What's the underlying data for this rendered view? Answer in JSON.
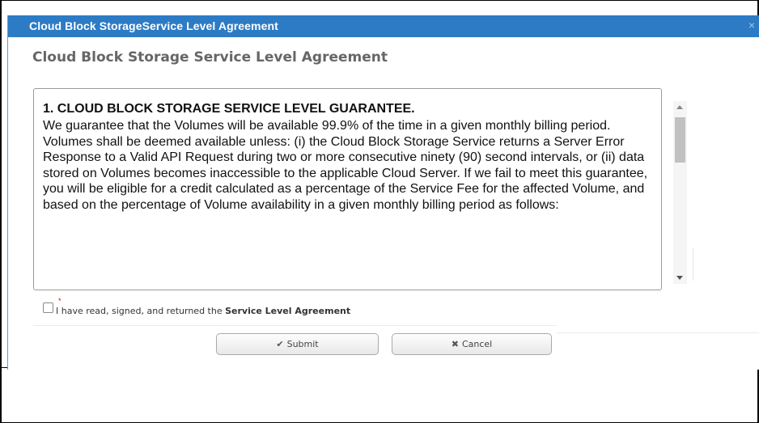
{
  "dialog": {
    "title": "Cloud Block StorageService Level Agreement",
    "heading": "Cloud Block Storage Service Level Agreement",
    "close_icon": "×"
  },
  "agreement": {
    "section_heading": "1. CLOUD BLOCK STORAGE SERVICE LEVEL GUARANTEE.",
    "body": "We guarantee that the Volumes will be available 99.9% of the time in a given monthly billing period. Volumes shall be deemed available unless: (i) the Cloud Block Storage Service returns a Server Error Response to a Valid API Request during two or more consecutive ninety (90) second intervals, or (ii) data stored on Volumes becomes inaccessible to the applicable Cloud Server. If we fail to meet this guarantee, you will be eligible for a credit calculated as a percentage of the Service Fee for the affected Volume, and based on the percentage of Volume availability in a given monthly billing period as follows:"
  },
  "checkbox": {
    "required_mark": "*",
    "label_prefix": "I have read, signed, and returned the ",
    "label_strong": "Service Level Agreement",
    "checked": false
  },
  "buttons": {
    "submit": {
      "icon": "✔",
      "label": "Submit"
    },
    "cancel": {
      "icon": "✖",
      "label": "Cancel"
    }
  },
  "colors": {
    "titlebar": "#2d7bc4",
    "heading_text": "#666666",
    "required": "#e00000"
  }
}
